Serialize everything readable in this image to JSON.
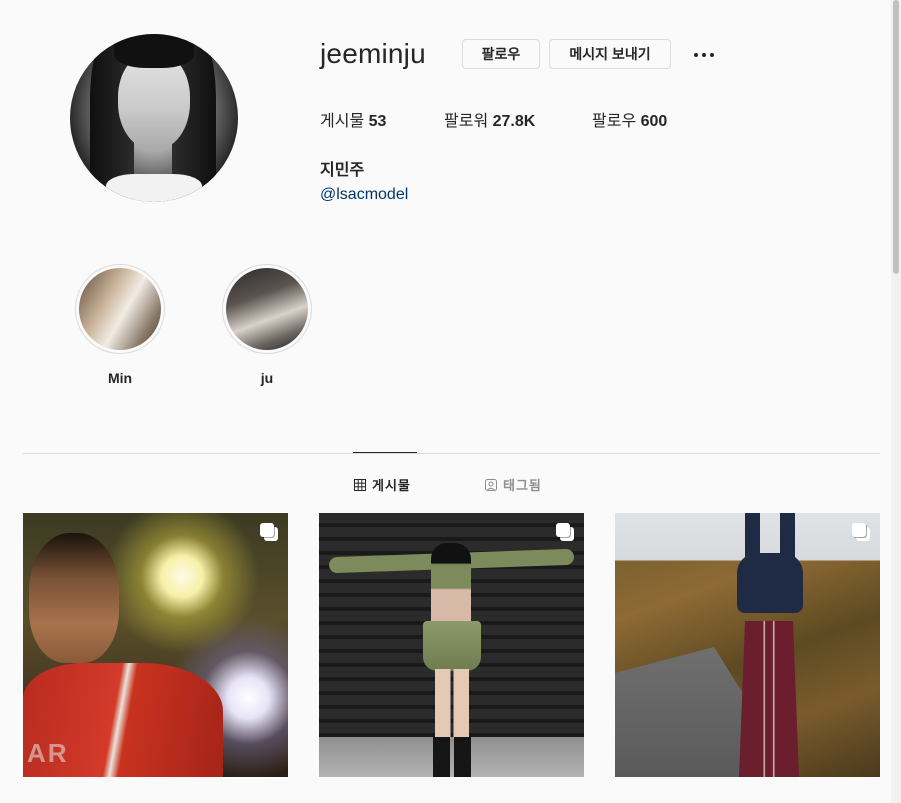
{
  "profile": {
    "username": "jeeminju",
    "full_name": "지민주",
    "bio_link": "@lsacmodel",
    "follow_button": "팔로우",
    "message_button": "메시지 보내기",
    "more_icon": "more-options-icon",
    "stats": {
      "posts_label": "게시물",
      "posts_count": "53",
      "followers_label": "팔로워",
      "followers_count": "27.8K",
      "following_label": "팔로우",
      "following_count": "600"
    }
  },
  "highlights": [
    {
      "label": "Min"
    },
    {
      "label": "ju"
    }
  ],
  "tabs": [
    {
      "label": "게시물",
      "icon": "grid-icon",
      "active": true
    },
    {
      "label": "태그됨",
      "icon": "tagged-icon",
      "active": false
    }
  ],
  "posts": [
    {
      "icon": "multiple-images-icon",
      "watermark": "AR"
    },
    {
      "icon": "multiple-images-icon"
    },
    {
      "icon": "multiple-images-icon"
    }
  ],
  "colors": {
    "background": "#fafafa",
    "text": "#262626",
    "link": "#00376b",
    "muted": "#8e8e8e",
    "border": "#dbdbdb"
  }
}
